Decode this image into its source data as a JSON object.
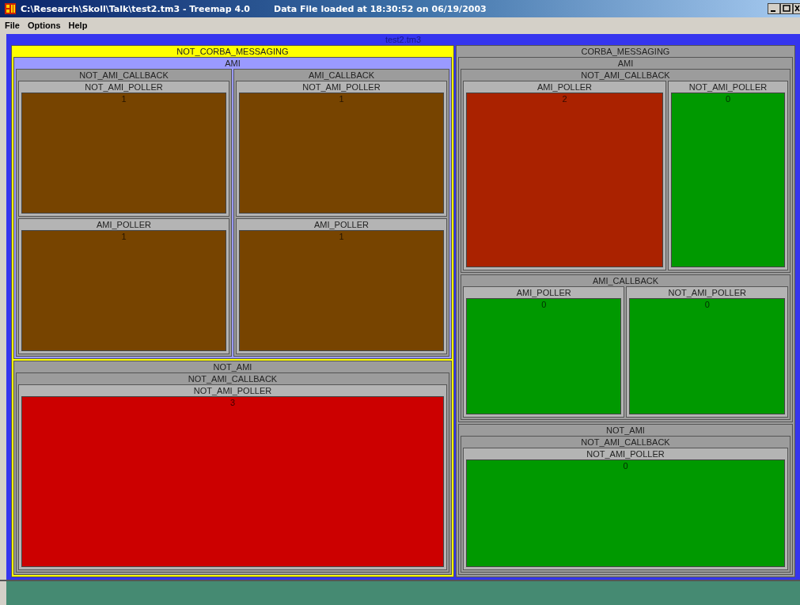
{
  "window": {
    "title": "C:\\Research\\Skoll\\Talk\\test2.tm3 - Treemap 4.0",
    "status": "Data File loaded at 18:30:52 on 06/19/2003"
  },
  "menu": [
    "File",
    "Options",
    "Help"
  ],
  "treemap": {
    "label": "test2.tm3",
    "color": "#3535ee",
    "children": [
      {
        "label": "NOT_CORBA_MESSAGING",
        "color": "#ffff00",
        "children": [
          {
            "label": "AMI",
            "color": "#9a9aff",
            "children": [
              {
                "label": "NOT_AMI_CALLBACK",
                "children": [
                  {
                    "label": "NOT_AMI_POLLER",
                    "value": "1",
                    "color": "#774400"
                  },
                  {
                    "label": "AMI_POLLER",
                    "value": "1",
                    "color": "#774400"
                  }
                ]
              },
              {
                "label": "AMI_CALLBACK",
                "children": [
                  {
                    "label": "NOT_AMI_POLLER",
                    "value": "1",
                    "color": "#774400"
                  },
                  {
                    "label": "AMI_POLLER",
                    "value": "1",
                    "color": "#774400"
                  }
                ]
              }
            ]
          },
          {
            "label": "NOT_AMI",
            "children": [
              {
                "label": "NOT_AMI_CALLBACK",
                "children": [
                  {
                    "label": "NOT_AMI_POLLER",
                    "value": "3",
                    "color": "#cc0000"
                  }
                ]
              }
            ]
          }
        ]
      },
      {
        "label": "CORBA_MESSAGING",
        "children": [
          {
            "label": "AMI",
            "children": [
              {
                "label": "NOT_AMI_CALLBACK",
                "children": [
                  {
                    "label": "AMI_POLLER",
                    "value": "2",
                    "color": "#aa2200"
                  },
                  {
                    "label": "NOT_AMI_POLLER",
                    "value": "0",
                    "color": "#009900"
                  }
                ]
              },
              {
                "label": "AMI_CALLBACK",
                "children": [
                  {
                    "label": "AMI_POLLER",
                    "value": "0",
                    "color": "#009900"
                  },
                  {
                    "label": "NOT_AMI_POLLER",
                    "value": "0",
                    "color": "#009900"
                  }
                ]
              }
            ]
          },
          {
            "label": "NOT_AMI",
            "children": [
              {
                "label": "NOT_AMI_CALLBACK",
                "children": [
                  {
                    "label": "NOT_AMI_POLLER",
                    "value": "0",
                    "color": "#009900"
                  }
                ]
              }
            ]
          }
        ]
      }
    ]
  }
}
